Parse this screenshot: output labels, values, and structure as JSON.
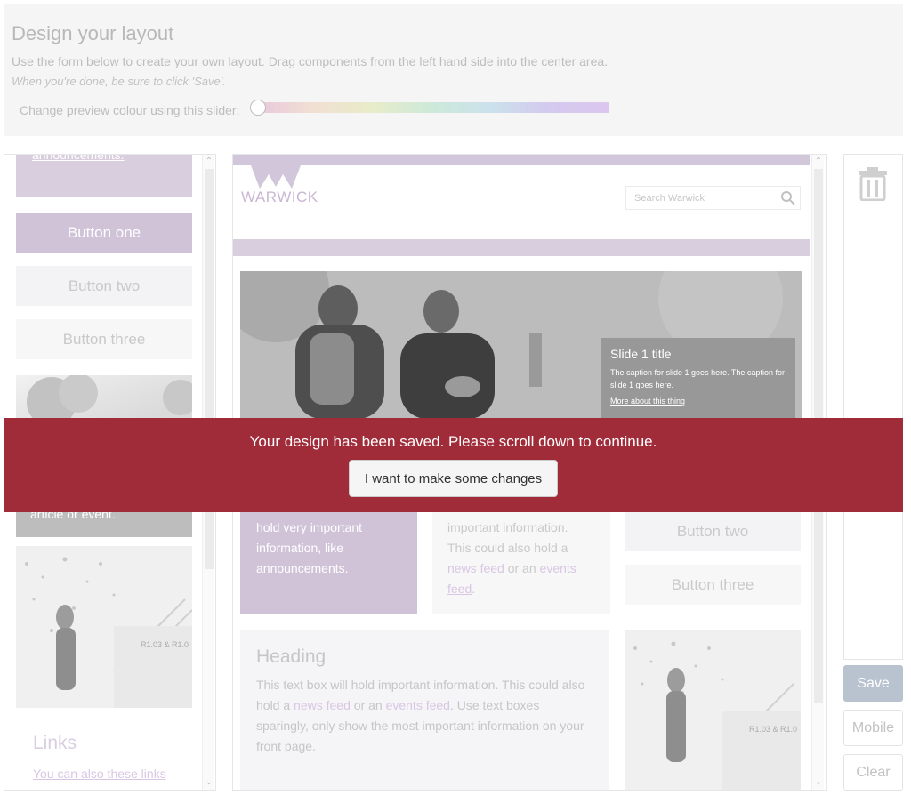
{
  "header": {
    "title": "Design your layout",
    "intro": "Use the form below to create your own layout. Drag components from the left hand side into the center area.",
    "hint": "When you're done, be sure to click 'Save'.",
    "slider_label": "Change preview colour using this slider:"
  },
  "left_panel": {
    "top_link": "announcements.",
    "buttons": [
      "Button one",
      "Button two",
      "Button three"
    ],
    "image_caption": "article or event.",
    "links_heading": "Links",
    "links_text": "You can also these links"
  },
  "preview": {
    "logo_text": "WARWICK",
    "search_placeholder": "Search Warwick",
    "slide": {
      "title": "Slide 1 title",
      "caption": "The caption for slide 1 goes here. The caption for slide 1 goes here.",
      "link": "More about this thing"
    },
    "purple_block": {
      "line1": "hold very important",
      "line2": "information, like",
      "link": "announcements",
      "after": "."
    },
    "text_block": {
      "line1": "important information.",
      "line2": "This could also hold a",
      "link1": "news feed",
      "mid": " or an ",
      "link2": "events",
      "link2b": "feed",
      "after": "."
    },
    "buttons": [
      "Button two",
      "Button three"
    ],
    "heading_block": {
      "heading": "Heading",
      "text_a": "This text box will hold important information. This could also hold a ",
      "link1": "news feed",
      "text_b": " or an ",
      "link2": "events feed",
      "text_c": ". Use text boxes sparingly, only show the most important information on your front page."
    }
  },
  "actions": {
    "save": "Save",
    "mobile": "Mobile",
    "clear": "Clear"
  },
  "banner": {
    "message": "Your design has been saved. Please scroll down to continue.",
    "button": "I want to make some changes"
  },
  "colors": {
    "accent_purple": "#d0c3d8",
    "banner_red": "#a02c39",
    "save_blue": "#b8c3cf"
  }
}
